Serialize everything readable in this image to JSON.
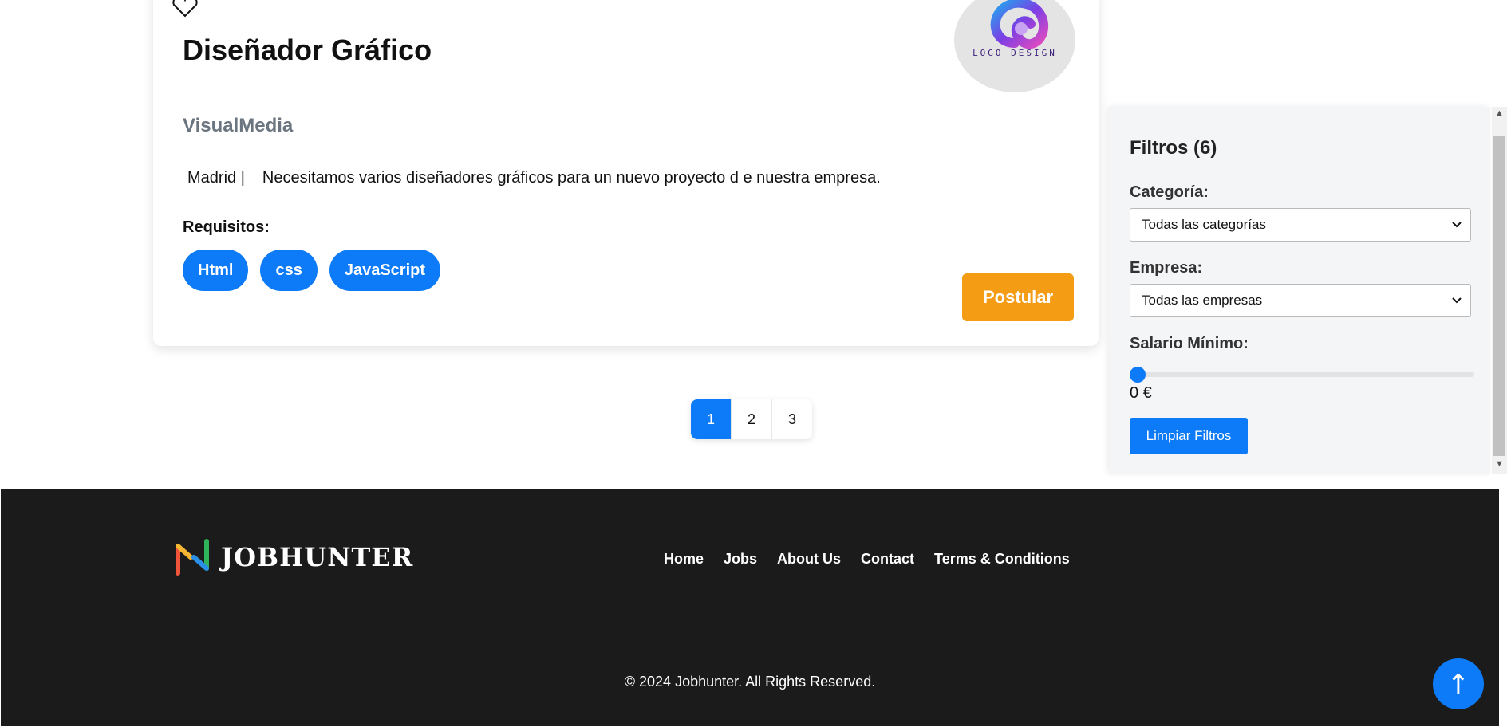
{
  "job_card": {
    "title": "Diseñador Gráfico",
    "company": "VisualMedia",
    "logo_text": "LOGO DESIGN",
    "location": "Madrid |",
    "description": "Necesitamos varios diseñadores gráficos para un nuevo proyecto d e nuestra empresa.",
    "requirements_label": "Requisitos:",
    "tags": [
      "Html",
      "css",
      "JavaScript"
    ],
    "apply_label": "Postular"
  },
  "pagination": {
    "pages": [
      "1",
      "2",
      "3"
    ],
    "active": "1"
  },
  "filters": {
    "title": "Filtros (6)",
    "category_label": "Categoría:",
    "category_value": "Todas las categorías",
    "company_label": "Empresa:",
    "company_value": "Todas las empresas",
    "salary_label": "Salario Mínimo:",
    "salary_value": "0 €",
    "salary_fraction": 0,
    "clear_label": "Limpiar Filtros"
  },
  "footer": {
    "brand": "JOBHUNTER",
    "nav": [
      "Home",
      "Jobs",
      "About Us",
      "Contact",
      "Terms & Conditions"
    ],
    "copyright": "© 2024 Jobhunter. All Rights Reserved."
  },
  "scroll_top_label": "↑",
  "colors": {
    "primary": "#0d7bf7",
    "accent": "#f39c14",
    "footer_bg": "#1b1b1b"
  }
}
